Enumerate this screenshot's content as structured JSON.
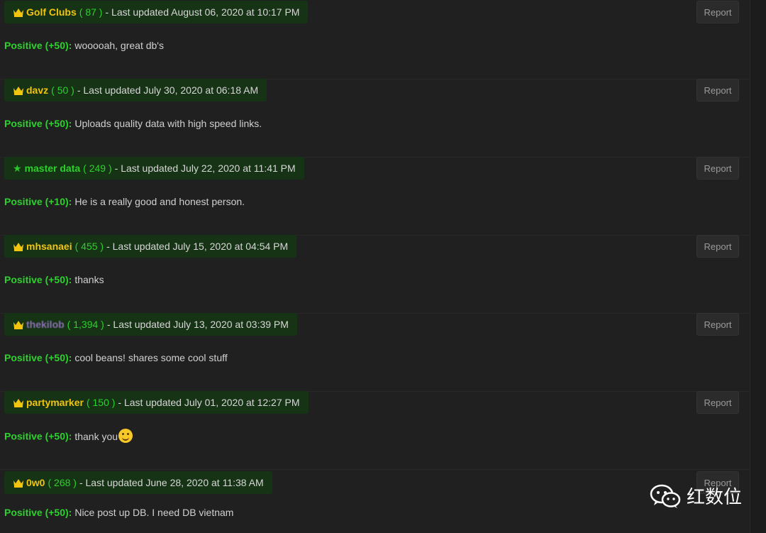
{
  "report_label": "Report",
  "entries": [
    {
      "username": "Golf Clubs",
      "badge": "crown",
      "count": "87",
      "updated": "Last updated August 06, 2020 at 10:17 PM",
      "rating": "Positive (+50):",
      "comment": "wooooah, great db's"
    },
    {
      "username": "davz",
      "badge": "crown",
      "count": "50",
      "updated": "Last updated July 30, 2020 at 06:18 AM",
      "rating": "Positive (+50):",
      "comment": "Uploads quality data with high speed links."
    },
    {
      "username": "master data",
      "badge": "star",
      "count": "249",
      "updated": "Last updated July 22, 2020 at 11:41 PM",
      "rating": "Positive (+10):",
      "comment": "He is a really good and honest person."
    },
    {
      "username": "mhsanaei",
      "badge": "crown",
      "count": "455",
      "updated": "Last updated July 15, 2020 at 04:54 PM",
      "rating": "Positive (+50):",
      "comment": "thanks"
    },
    {
      "username": "thekilob",
      "badge": "crown",
      "count": "1,394",
      "updated": "Last updated July 13, 2020 at 03:39 PM",
      "rating": "Positive (+50):",
      "comment": "cool beans! shares some cool stuff"
    },
    {
      "username": "partymarker",
      "badge": "crown",
      "count": "150",
      "updated": "Last updated July 01, 2020 at 12:27 PM",
      "rating": "Positive (+50):",
      "comment": "thank you"
    },
    {
      "username": "0w0",
      "badge": "crown",
      "count": "268",
      "updated": "Last updated June 28, 2020 at 11:38 AM",
      "rating": "Positive (+50):",
      "comment": "Nice post up DB. I need DB vietnam"
    }
  ],
  "watermark": {
    "text": "红数位",
    "icon": "wechat-icon"
  },
  "colors": {
    "background": "#202020",
    "header_bg": "#163316",
    "positive_green": "#2dd12d",
    "username_gold": "#f1c40f"
  }
}
